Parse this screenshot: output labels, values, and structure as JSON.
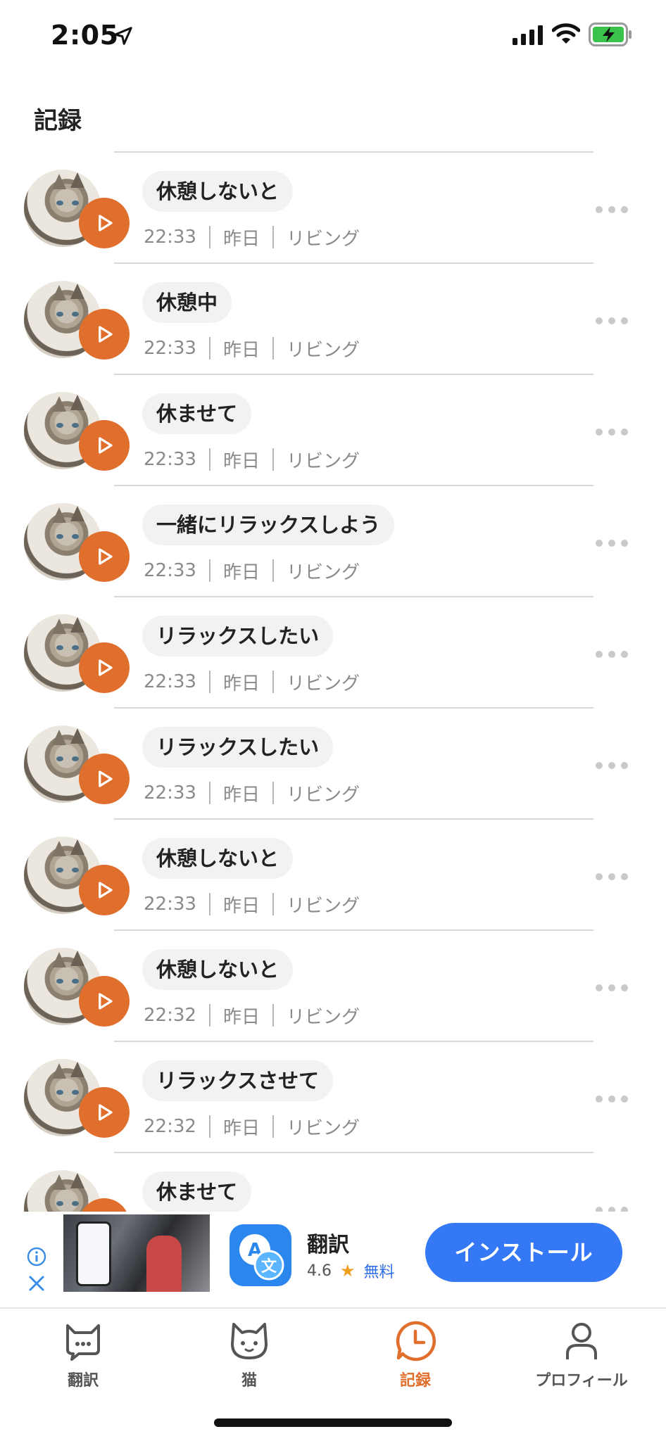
{
  "status_bar": {
    "time": "2:05"
  },
  "header": {
    "title": "記録"
  },
  "history": {
    "items": [
      {
        "phrase": "休憩しないと",
        "time": "22:33",
        "day": "昨日",
        "place": "リビング"
      },
      {
        "phrase": "休憩中",
        "time": "22:33",
        "day": "昨日",
        "place": "リビング"
      },
      {
        "phrase": "休ませて",
        "time": "22:33",
        "day": "昨日",
        "place": "リビング"
      },
      {
        "phrase": "一緒にリラックスしよう",
        "time": "22:33",
        "day": "昨日",
        "place": "リビング"
      },
      {
        "phrase": "リラックスしたい",
        "time": "22:33",
        "day": "昨日",
        "place": "リビング"
      },
      {
        "phrase": "リラックスしたい",
        "time": "22:33",
        "day": "昨日",
        "place": "リビング"
      },
      {
        "phrase": "休憩しないと",
        "time": "22:33",
        "day": "昨日",
        "place": "リビング"
      },
      {
        "phrase": "休憩しないと",
        "time": "22:32",
        "day": "昨日",
        "place": "リビング"
      },
      {
        "phrase": "リラックスさせて",
        "time": "22:32",
        "day": "昨日",
        "place": "リビング"
      },
      {
        "phrase": "休ませて",
        "time": "",
        "day": "",
        "place": ""
      }
    ]
  },
  "ad": {
    "app_name": "翻訳",
    "rating": "4.6",
    "price": "無料",
    "install_label": "インストール"
  },
  "tab_bar": {
    "tabs": [
      {
        "label": "翻訳",
        "icon": "cat-speech-icon",
        "active": false
      },
      {
        "label": "猫",
        "icon": "cat-face-icon",
        "active": false
      },
      {
        "label": "記録",
        "icon": "clock-icon",
        "active": true
      },
      {
        "label": "プロフィール",
        "icon": "person-icon",
        "active": false
      }
    ]
  },
  "colors": {
    "accent": "#e06e2c",
    "install_button": "#3478f6",
    "bubble_bg": "#f2f2f2",
    "meta_text": "#8a8a8a"
  }
}
